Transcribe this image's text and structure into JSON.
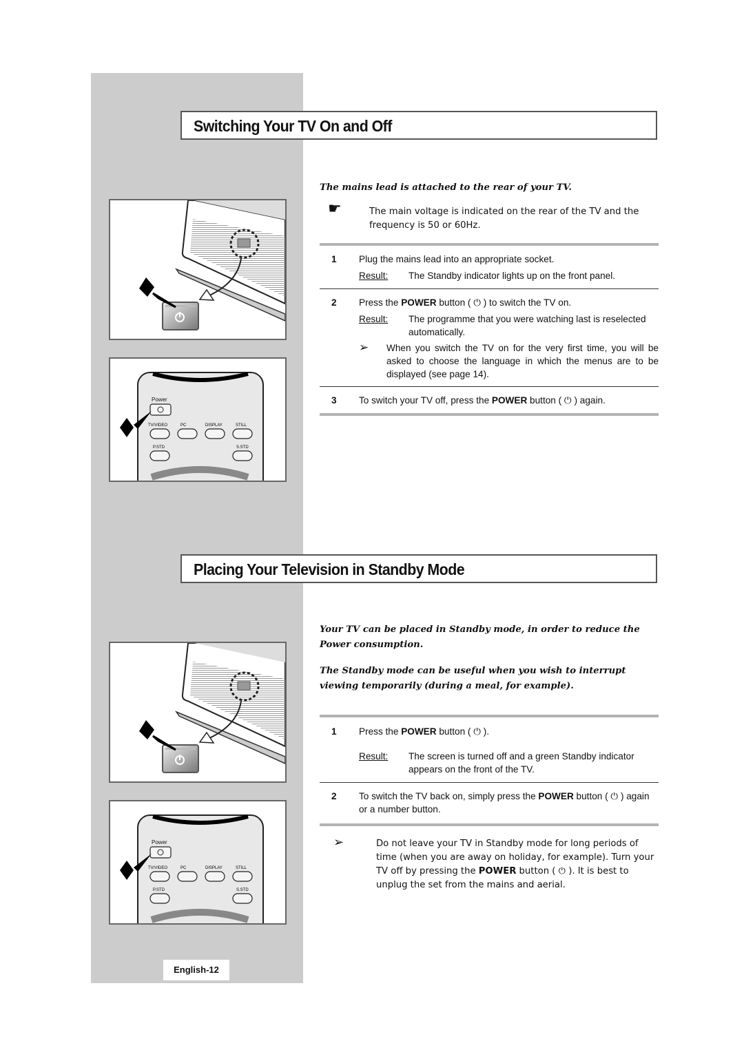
{
  "section1": {
    "title": "Switching Your TV On and Off",
    "lead": "The mains lead is attached to the rear of your TV.",
    "note_icon": "pointing-hand-icon",
    "note": "The main voltage is indicated on the rear of the TV and the frequency is 50 or 60Hz.",
    "steps": [
      {
        "num": "1",
        "text": "Plug the mains lead into an appropriate socket.",
        "result_label": "Result:",
        "result": "The Standby indicator lights up on the front panel."
      },
      {
        "num": "2",
        "text_before": "Press the ",
        "keyword": "POWER",
        "text_after": " button ( ⏻ ) to switch the TV on.",
        "result_label": "Result:",
        "result": "The programme that you were watching last is reselected automatically.",
        "tip": "When you switch the TV on for the very first time, you will be asked to choose the language in which the menus are to be displayed (see page 14)."
      },
      {
        "num": "3",
        "text_before": "To switch your TV off, press the ",
        "keyword": "POWER",
        "text_after": " button ( ⏻ ) again."
      }
    ]
  },
  "section2": {
    "title": "Placing Your Television in Standby Mode",
    "lead1": "Your TV can be placed in Standby mode, in order to reduce the Power consumption.",
    "lead2": "The Standby mode can be useful when you wish to interrupt viewing temporarily (during a meal, for example).",
    "steps": [
      {
        "num": "1",
        "text_before": "Press the ",
        "keyword": "POWER",
        "text_after": " button ( ⏻ ).",
        "result_label": "Result:",
        "result": "The screen is turned off and a green Standby indicator appears on the front of the TV."
      },
      {
        "num": "2",
        "text_before": "To switch the TV back on, simply press the ",
        "keyword": "POWER",
        "text_after": " button ( ⏻ ) again or a number button."
      }
    ],
    "tip_line1": "Do not leave your TV in Standby mode for long periods of time (when you are away on holiday, for example). Turn your TV off by pressing the ",
    "tip_keyword": "POWER",
    "tip_line2": " button ( ⏻ ). It is best to unplug the set from the mains and aerial."
  },
  "remote": {
    "power_label": "Power",
    "buttons": [
      "TV/VIDEO",
      "PC",
      "DISPLAY",
      "STILL"
    ],
    "buttons_row2": [
      "P.STD",
      "S.STD"
    ]
  },
  "footer": {
    "page_label": "English-12"
  }
}
